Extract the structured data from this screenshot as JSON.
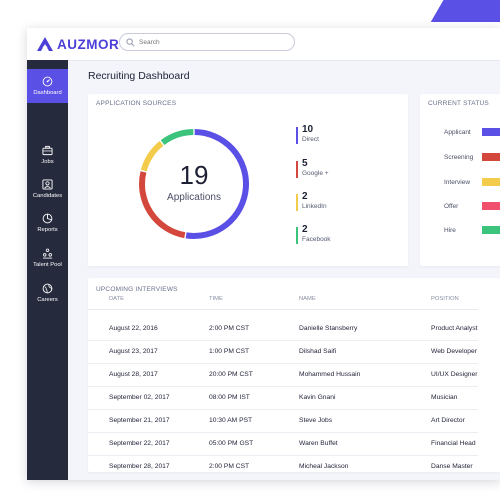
{
  "app": {
    "logo_text": "AUZMOR",
    "search_placeholder": "Search"
  },
  "sidebar": {
    "items": [
      {
        "label": "Dashboard",
        "icon": "dashboard-gauge-icon",
        "active": true
      },
      {
        "label": "Jobs",
        "icon": "briefcase-icon",
        "active": false
      },
      {
        "label": "Candidates",
        "icon": "candidates-icon",
        "active": false
      },
      {
        "label": "Reports",
        "icon": "pie-chart-icon",
        "active": false
      },
      {
        "label": "Talent Pool",
        "icon": "talent-pool-icon",
        "active": false
      },
      {
        "label": "Careers",
        "icon": "careers-globe-icon",
        "active": false
      }
    ]
  },
  "page_title": "Recruiting Dashboard",
  "application_sources": {
    "title": "APPLICATION SOURCES",
    "total": "19",
    "total_label": "Applications",
    "sources": [
      {
        "count": "10",
        "name": "Direct",
        "color": "#5b50e6"
      },
      {
        "count": "5",
        "name": "Google +",
        "color": "#d4473c"
      },
      {
        "count": "2",
        "name": "LinkedIn",
        "color": "#f2cc4a"
      },
      {
        "count": "2",
        "name": "Facebook",
        "color": "#3cc47c"
      }
    ]
  },
  "current_status": {
    "title": "CURRENT STATUS",
    "items": [
      {
        "label": "Applicant",
        "color": "#5b50e6"
      },
      {
        "label": "Screening",
        "color": "#d4473c"
      },
      {
        "label": "Interview",
        "color": "#f2cc4a"
      },
      {
        "label": "Offer",
        "color": "#f0506e"
      },
      {
        "label": "Hire",
        "color": "#3cc47c"
      }
    ]
  },
  "upcoming_interviews": {
    "title": "UPCOMING INTERVIEWS",
    "columns": [
      "DATE",
      "TIME",
      "NAME",
      "POSITION"
    ],
    "rows": [
      {
        "date": "August 22, 2016",
        "time": "2:00 PM CST",
        "name": "Danielle Stansberry",
        "position": "Product Analyst"
      },
      {
        "date": "August 23, 2017",
        "time": "1:00 PM CST",
        "name": "Dilshad Saifi",
        "position": "Web Developer"
      },
      {
        "date": "August 28, 2017",
        "time": "20:00 PM CST",
        "name": "Mohammed Hussain",
        "position": "UI/UX Designer"
      },
      {
        "date": "September 02, 2017",
        "time": "08:00 PM IST",
        "name": "Kavin Gnani",
        "position": "Musician"
      },
      {
        "date": "September 21, 2017",
        "time": "10:30 AM PST",
        "name": "Steve Jobs",
        "position": "Art Director"
      },
      {
        "date": "September 22, 2017",
        "time": "05:00 PM GST",
        "name": "Waren Buffet",
        "position": "Financial Head"
      },
      {
        "date": "September 28, 2017",
        "time": "2:00 PM CST",
        "name": "Micheal Jackson",
        "position": "Danse Master"
      }
    ]
  }
}
